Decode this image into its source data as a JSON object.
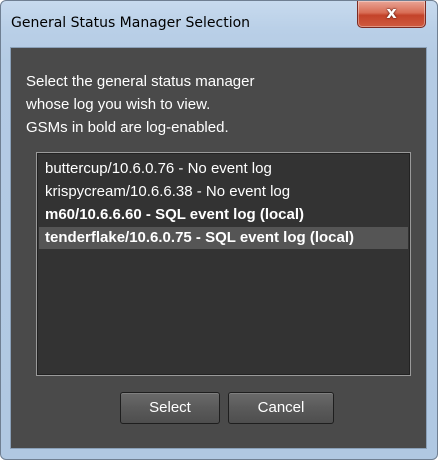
{
  "window": {
    "title": "General Status Manager Selection",
    "close_glyph": "x"
  },
  "message": {
    "lines": [
      "Select the general status manager",
      "whose log you wish to view.",
      "GSMs in bold are log-enabled."
    ]
  },
  "gsm_list": {
    "items": [
      {
        "label": "buttercup/10.6.0.76 - No event log",
        "bold": false,
        "selected": false
      },
      {
        "label": "krispycream/10.6.6.38 - No event log",
        "bold": false,
        "selected": false
      },
      {
        "label": "m60/10.6.6.60 - SQL event log (local)",
        "bold": true,
        "selected": false
      },
      {
        "label": "tenderflake/10.6.0.75 - SQL event log (local)",
        "bold": true,
        "selected": true
      }
    ]
  },
  "buttons": {
    "select_label": "Select",
    "cancel_label": "Cancel"
  },
  "colors": {
    "title_bar": "#b9cfe7",
    "client_bg": "#4a4a4a",
    "list_bg": "#333333",
    "selection": "#555555",
    "close_button": "#c3432a"
  },
  "icons": {
    "close": "close-icon"
  }
}
